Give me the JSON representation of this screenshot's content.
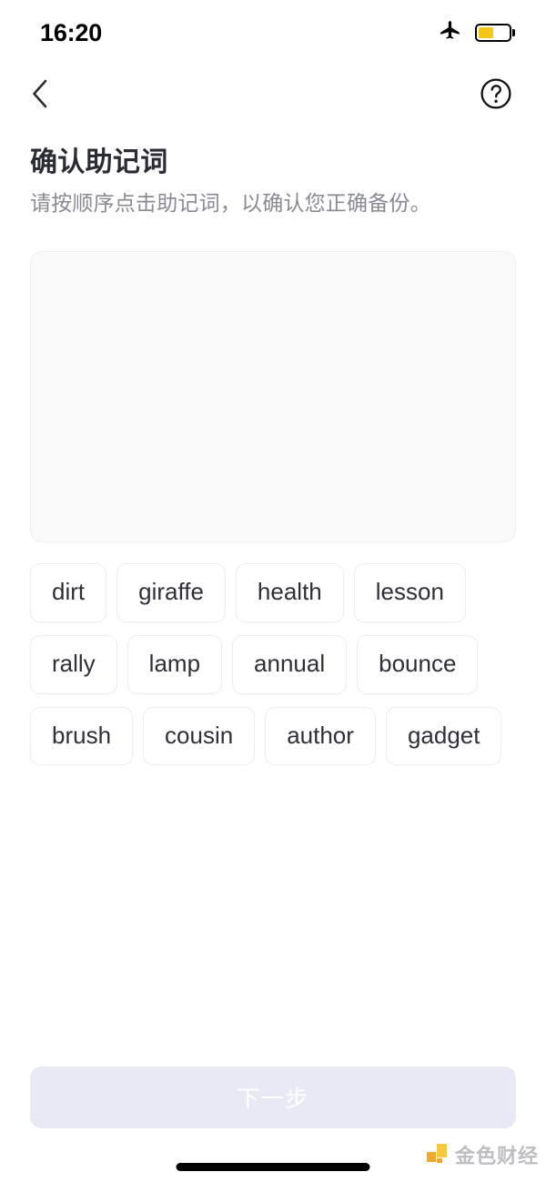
{
  "status_bar": {
    "time": "16:20",
    "airplane_icon": "airplane-mode-icon",
    "battery_icon": "battery-icon",
    "battery_level_percent": 50,
    "battery_color": "#f5c518"
  },
  "nav": {
    "back_icon": "chevron-left-icon",
    "help_icon": "question-circle-icon"
  },
  "header": {
    "title": "确认助记词",
    "subtitle": "请按顺序点击助记词，以确认您正确备份。"
  },
  "answer_box": {
    "selected_words": [],
    "background_color": "#fafafa"
  },
  "word_pool": {
    "words": [
      "dirt",
      "giraffe",
      "health",
      "lesson",
      "rally",
      "lamp",
      "annual",
      "bounce",
      "brush",
      "cousin",
      "author",
      "gadget"
    ]
  },
  "footer": {
    "next_label": "下一步",
    "next_enabled": false,
    "next_background_color": "#e9e9f6"
  },
  "watermark": {
    "text": "金色财经",
    "logo_color": "#f5c431"
  }
}
